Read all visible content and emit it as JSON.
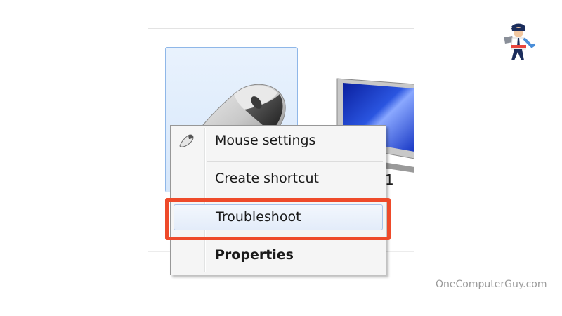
{
  "context_menu": {
    "items": [
      {
        "label": "Mouse settings",
        "icon": "mouse-icon"
      },
      {
        "label": "Create shortcut"
      },
      {
        "label": "Troubleshoot",
        "highlighted": true
      },
      {
        "label": "Properties",
        "bold": true
      }
    ]
  },
  "device_partial_label": "1",
  "watermark": "OneComputerGuy.com",
  "colors": {
    "highlight_box": "#ee4a2a",
    "tile_border": "#8fb7e8",
    "tile_fill": "#dbe9fb",
    "menu_background": "#f5f5f5"
  }
}
